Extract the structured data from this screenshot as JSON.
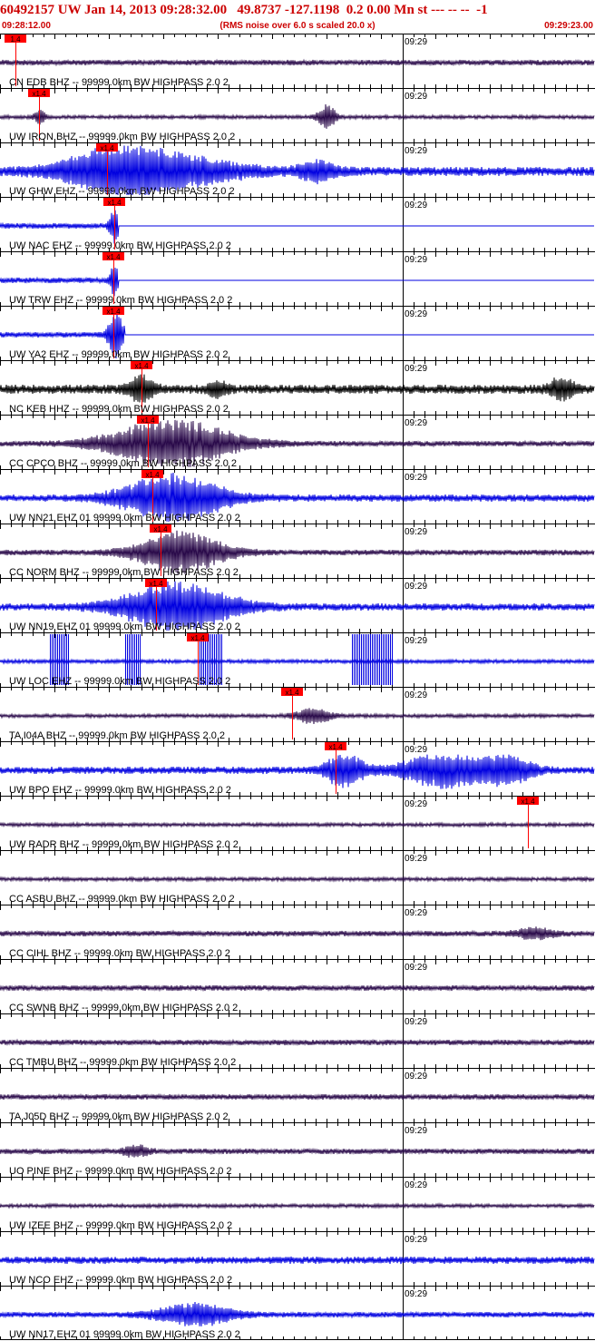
{
  "header": {
    "title": "60492157 UW Jan 14, 2013 09:28:32.00   49.8737 -127.1198  0.2 0.00 Mn st --- -- --  -1",
    "start_time": "09:28:12.00",
    "note": "(RMS noise over 6.0 s scaled 20.0 x)",
    "end_time": "09:29:23.00"
  },
  "chart_data": {
    "type": "line",
    "title": "60492157 UW Jan 14, 2013 09:28:32.00   49.8737 -127.1198  0.2 0.00 Mn st --- -- --  -1",
    "x_range": [
      "09:28:12.00",
      "09:29:23.00"
    ],
    "tick_label": "09:29",
    "grid": true,
    "colors": {
      "blue": "#0000e0",
      "dark": "#2a0a4a",
      "black": "#000000",
      "pick": "#ff0000"
    },
    "traces": [
      {
        "label": "CN EDB BHZ -- 99999.0km BW  HIGHPASS  2.0  2",
        "pick": "1.4",
        "pick_x": 17,
        "color": "dark",
        "events": [],
        "amp": 3
      },
      {
        "label": "UW IRON BHZ -- 99999.0km BW  HIGHPASS  2.0  2",
        "pick": "x1.4",
        "pick_x": 43,
        "color": "dark",
        "events": [
          [
            44,
            8,
            10
          ],
          [
            360,
            14,
            14
          ]
        ],
        "amp": 2
      },
      {
        "label": "UW GHW EHZ -- 99999.0km BW  HIGHPASS  2.0  2",
        "pick": "x1.4",
        "pick_x": 118,
        "color": "blue",
        "events": [
          [
            120,
            80,
            14
          ],
          [
            175,
            120,
            18
          ],
          [
            350,
            30,
            10
          ]
        ],
        "amp": 5
      },
      {
        "label": "UW NAC EHZ -- 99999.0km BW  HIGHPASS  2.0  2",
        "pick": "x1.4",
        "pick_x": 126,
        "color": "blue",
        "events": [
          [
            126,
            8,
            20
          ]
        ],
        "amp": 3,
        "flat_after": 130
      },
      {
        "label": "UW TRW EHZ -- 99999.0km BW  HIGHPASS  2.0  2",
        "pick": "x1.4",
        "pick_x": 125,
        "color": "blue",
        "events": [
          [
            126,
            6,
            20
          ]
        ],
        "amp": 3,
        "flat_after": 130
      },
      {
        "label": "UW YA2 EHZ -- 99999.0km BW  HIGHPASS  2.0  2",
        "pick": "x1.4",
        "pick_x": 125,
        "color": "blue",
        "events": [
          [
            128,
            12,
            28
          ]
        ],
        "amp": 3,
        "flat_after": 137
      },
      {
        "label": "NC KEB HHZ -- 99999.0km BW  HIGHPASS  2.0  2",
        "pick": "x1.4",
        "pick_x": 156,
        "color": "black",
        "events": [
          [
            156,
            20,
            14
          ],
          [
            240,
            16,
            8
          ],
          [
            620,
            20,
            12
          ]
        ],
        "amp": 5
      },
      {
        "label": "CC CPCO BHZ -- 99999.0km BW  HIGHPASS  2.0  2",
        "pick": "x1.4",
        "pick_x": 163,
        "color": "dark",
        "events": [
          [
            190,
            100,
            26
          ]
        ],
        "amp": 3
      },
      {
        "label": "UW NN21 EHZ 01 99999.0km BW  HIGHPASS  2.0  2",
        "pick": "x1.4",
        "pick_x": 168,
        "color": "blue",
        "events": [
          [
            190,
            80,
            26
          ]
        ],
        "amp": 4
      },
      {
        "label": "CC NORM BHZ -- 99999.0km BW  HIGHPASS  2.0  2",
        "pick": "x1.4",
        "pick_x": 177,
        "color": "dark",
        "events": [
          [
            200,
            70,
            22
          ]
        ],
        "amp": 3
      },
      {
        "label": "UW NN19 EHZ 01 99999.0km BW  HIGHPASS  2.0  2",
        "pick": "x1.4",
        "pick_x": 172,
        "color": "blue",
        "events": [
          [
            195,
            90,
            26
          ]
        ],
        "amp": 4
      },
      {
        "label": "UW LOC EHZ -- 99999.0km BW  HIGHPASS  2.0  2",
        "pick": "x1.4",
        "pick_x": 218,
        "color": "blue",
        "events": [],
        "amp": 2,
        "spikes": [
          [
            55,
            75
          ],
          [
            138,
            155
          ],
          [
            218,
            245
          ],
          [
            388,
            432
          ]
        ]
      },
      {
        "label": "TA I04A BHZ -- 99999.0km BW  HIGHPASS  2.0  2",
        "pick": "x1.4",
        "pick_x": 322,
        "color": "dark",
        "events": [
          [
            345,
            30,
            8
          ]
        ],
        "amp": 2
      },
      {
        "label": "UW BPO EHZ -- 99999.0km BW  HIGHPASS  2.0  2",
        "pick": "x1.4",
        "pick_x": 370,
        "color": "blue",
        "events": [
          [
            380,
            30,
            18
          ],
          [
            490,
            70,
            18
          ],
          [
            560,
            40,
            14
          ]
        ],
        "amp": 4
      },
      {
        "label": "UW RADR BHZ -- 99999.0km BW  HIGHPASS  2.0  2",
        "pick": "x1.4",
        "pick_x": 582,
        "color": "dark",
        "events": [],
        "amp": 2
      },
      {
        "label": "CC ASBU BHZ -- 99999.0km BW  HIGHPASS  2.0  2",
        "pick": "",
        "pick_x": null,
        "color": "dark",
        "events": [],
        "amp": 2
      },
      {
        "label": "CC CIHL BHZ -- 99999.0km BW  HIGHPASS  2.0  2",
        "pick": "",
        "pick_x": null,
        "color": "dark",
        "events": [
          [
            590,
            30,
            6
          ]
        ],
        "amp": 3
      },
      {
        "label": "CC SWNB BHZ -- 99999.0km BW  HIGHPASS  2.0  2",
        "pick": "",
        "pick_x": null,
        "color": "dark",
        "events": [],
        "amp": 3
      },
      {
        "label": "CC TMBU BHZ -- 99999.0km BW  HIGHPASS  2.0  2",
        "pick": "",
        "pick_x": null,
        "color": "dark",
        "events": [],
        "amp": 3
      },
      {
        "label": "TA J05D BHZ -- 99999.0km BW  HIGHPASS  2.0  2",
        "pick": "",
        "pick_x": null,
        "color": "dark",
        "events": [],
        "amp": 3
      },
      {
        "label": "UO PINE BHZ -- 99999.0km BW  HIGHPASS  2.0  2",
        "pick": "",
        "pick_x": null,
        "color": "dark",
        "events": [
          [
            150,
            20,
            6
          ]
        ],
        "amp": 3
      },
      {
        "label": "UW IZEE BHZ -- 99999.0km BW  HIGHPASS  2.0  2",
        "pick": "",
        "pick_x": null,
        "color": "dark",
        "events": [],
        "amp": 2
      },
      {
        "label": "UW NCO EHZ -- 99999.0km BW  HIGHPASS  2.0  2",
        "pick": "",
        "pick_x": null,
        "color": "blue",
        "events": [],
        "amp": 4
      },
      {
        "label": "UW NN17 EHZ 01 99999.0km BW  HIGHPASS  2.0  2",
        "pick": "",
        "pick_x": null,
        "color": "blue",
        "events": [
          [
            215,
            60,
            12
          ]
        ],
        "amp": 3
      }
    ]
  }
}
